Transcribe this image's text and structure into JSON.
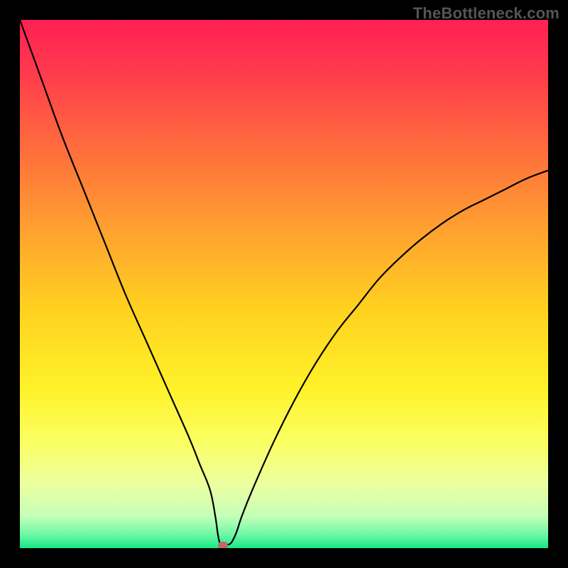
{
  "watermark": "TheBottleneck.com",
  "chart_data": {
    "type": "line",
    "title": "",
    "xlabel": "",
    "ylabel": "",
    "xlim": [
      0,
      100
    ],
    "ylim": [
      0,
      100
    ],
    "grid": false,
    "legend": false,
    "series": [
      {
        "name": "curve",
        "color": "#000000",
        "x": [
          0,
          4,
          8,
          12,
          16,
          20,
          24,
          28,
          32,
          34,
          36,
          37,
          37.5,
          38,
          38.5,
          39,
          40,
          41,
          42,
          44,
          48,
          52,
          56,
          60,
          64,
          68,
          72,
          76,
          80,
          84,
          88,
          92,
          96,
          100
        ],
        "values": [
          100,
          89,
          78,
          68,
          58,
          48,
          39,
          30,
          21,
          16,
          11,
          6,
          2.5,
          0.5,
          0.6,
          0.6,
          1,
          3,
          6,
          11,
          20,
          28,
          35,
          41,
          46,
          51,
          55,
          58.5,
          61.5,
          64,
          66,
          68,
          70,
          71.5
        ]
      }
    ],
    "marker": {
      "x": 38.5,
      "y": 0.5,
      "color": "#c06868"
    },
    "background_gradient": {
      "stops": [
        {
          "offset": 0.0,
          "color": "#ff1f55"
        },
        {
          "offset": 0.1,
          "color": "#ff3b4c"
        },
        {
          "offset": 0.25,
          "color": "#ff6f3c"
        },
        {
          "offset": 0.4,
          "color": "#ffa22f"
        },
        {
          "offset": 0.55,
          "color": "#ffd21f"
        },
        {
          "offset": 0.7,
          "color": "#fff22a"
        },
        {
          "offset": 0.8,
          "color": "#faff63"
        },
        {
          "offset": 0.88,
          "color": "#ecffa0"
        },
        {
          "offset": 0.94,
          "color": "#c4ffb8"
        },
        {
          "offset": 0.975,
          "color": "#6cf7a6"
        },
        {
          "offset": 1.0,
          "color": "#17e884"
        }
      ]
    }
  }
}
